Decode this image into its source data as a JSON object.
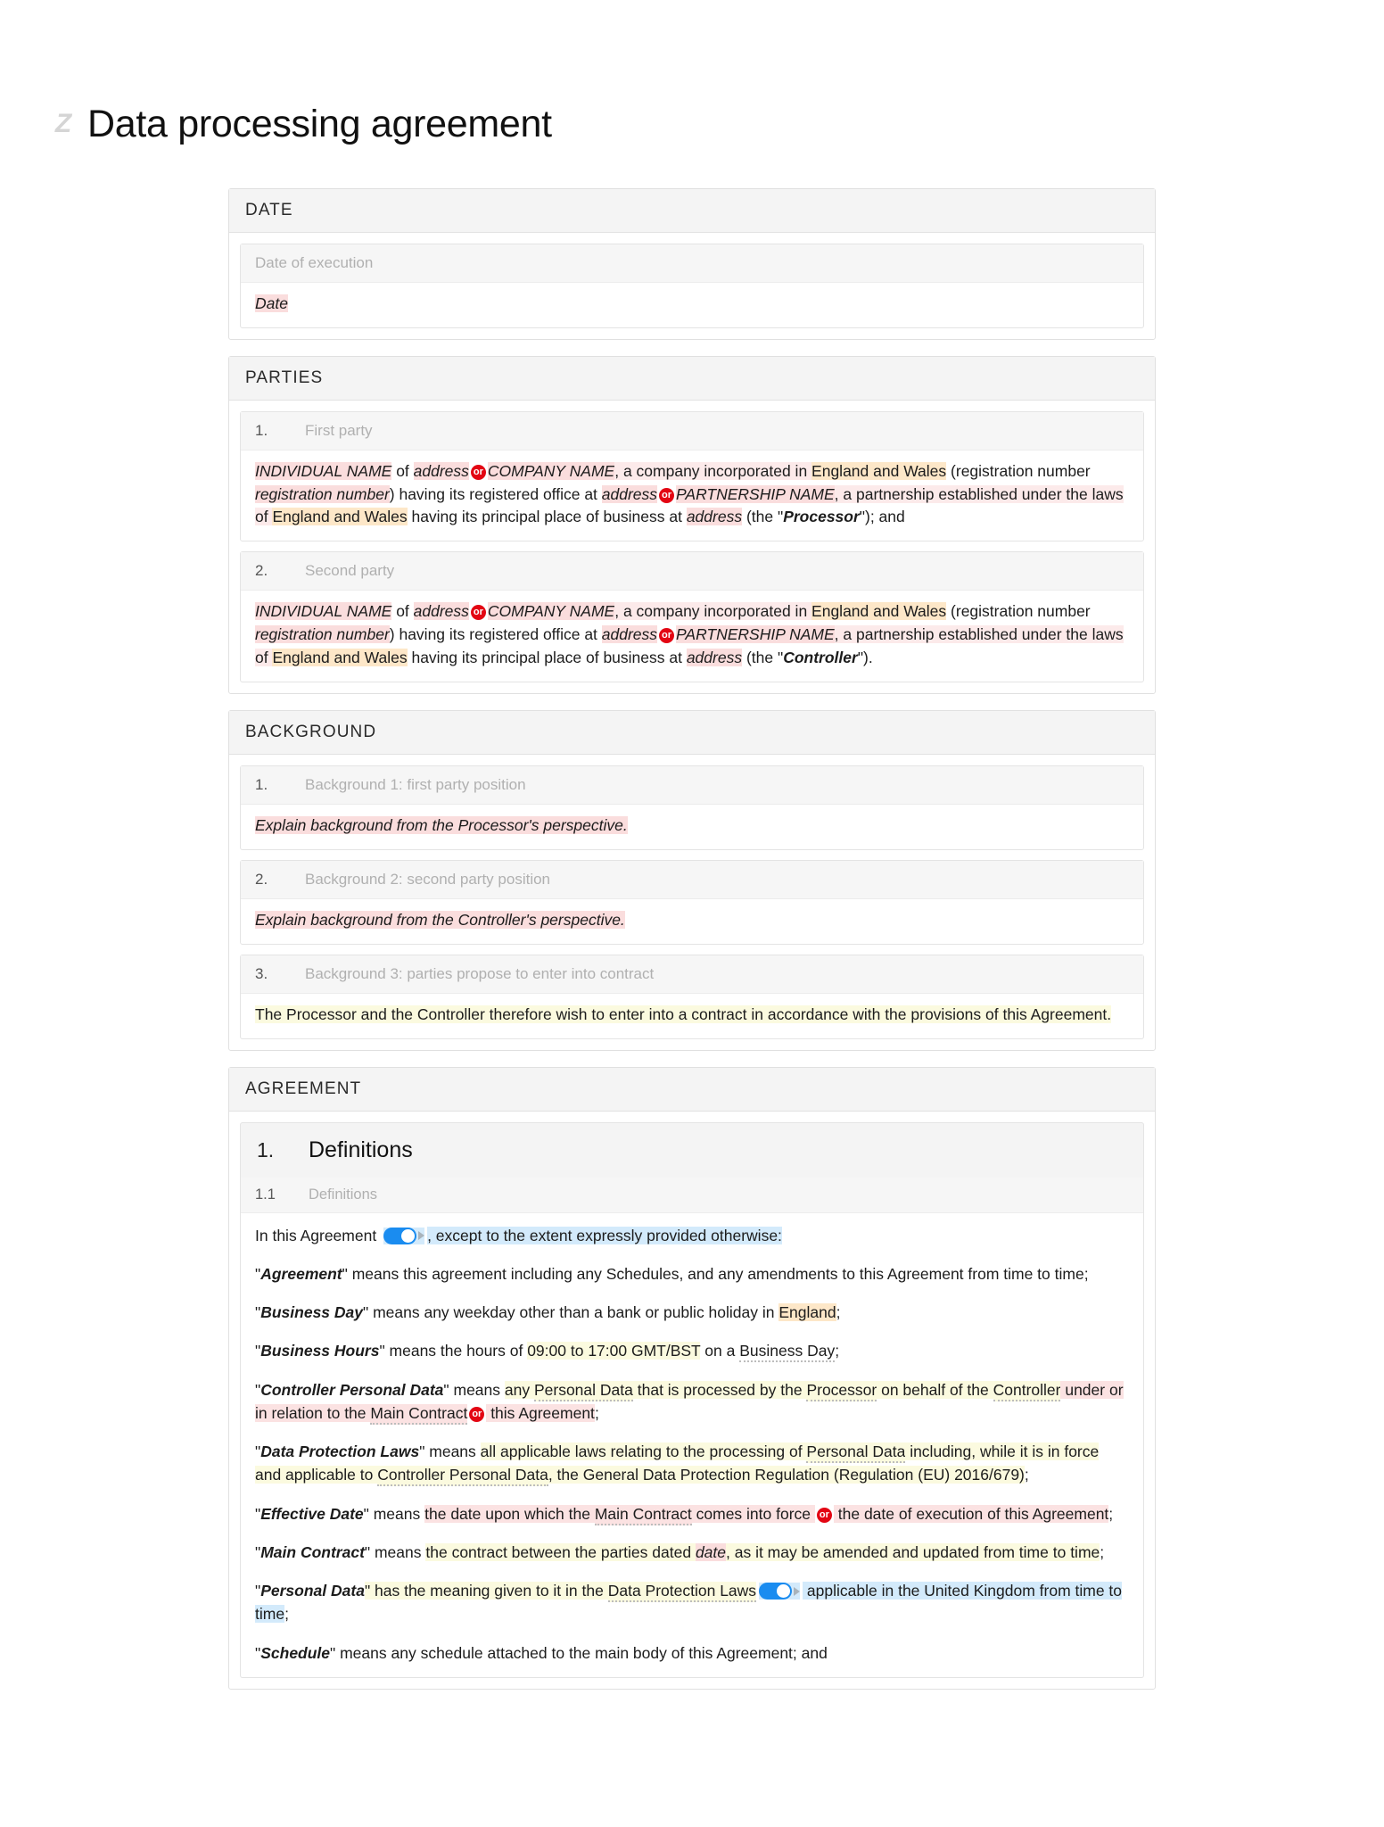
{
  "document": {
    "logo_glyph": "Z",
    "title": "Data processing agreement"
  },
  "sections": {
    "date": {
      "heading": "DATE",
      "clause_label": "Date of execution",
      "value": "Date"
    },
    "parties": {
      "heading": "PARTIES",
      "items": [
        {
          "num": "1.",
          "label": "First party",
          "role": "Processor",
          "text_plain": "INDIVIDUAL NAME of address or COMPANY NAME, a company incorporated in England and Wales (registration number registration number) having its registered office at address or PARTNERSHIP NAME, a partnership established under the laws of England and Wales having its principal place of business at address (the \"Processor\"); and",
          "parts": {
            "individual_name": "INDIVIDUAL NAME",
            "of": " of ",
            "address1": "address",
            "or": "or",
            "company_name": "COMPANY NAME",
            "incorporated": ", a company incorporated in ",
            "jurisdiction1": "England and Wales",
            "reg_open": " (registration number ",
            "registration_number": "registration number",
            "reg_close": ") having its registered office at ",
            "address2": "address",
            "partnership_name": "PARTNERSHIP NAME",
            "partnership_mid": ", a partnership established under the laws of ",
            "jurisdiction2": "England and Wales",
            "principal": " having its principal place of business at ",
            "address3": "address",
            "the_open": " (the \"",
            "the_close": "\"); and"
          }
        },
        {
          "num": "2.",
          "label": "Second party",
          "role": "Controller",
          "text_plain": "INDIVIDUAL NAME of address or COMPANY NAME, a company incorporated in England and Wales (registration number registration number) having its registered office at address or PARTNERSHIP NAME, a partnership established under the laws of England and Wales having its principal place of business at address (the \"Controller\").",
          "parts": {
            "individual_name": "INDIVIDUAL NAME",
            "of": " of ",
            "address1": "address",
            "or": "or",
            "company_name": "COMPANY NAME",
            "incorporated": ", a company incorporated in ",
            "jurisdiction1": "England and Wales",
            "reg_open": " (registration number ",
            "registration_number": "registration number",
            "reg_close": ") having its registered office at ",
            "address2": "address",
            "partnership_name": "PARTNERSHIP NAME",
            "partnership_mid": ", a partnership established under the laws of ",
            "jurisdiction2": "England and Wales",
            "principal": " having its principal place of business at ",
            "address3": "address",
            "the_open": " (the \"",
            "the_close": "\")."
          }
        }
      ]
    },
    "background": {
      "heading": "BACKGROUND",
      "items": [
        {
          "num": "1.",
          "label": "Background 1: first party position",
          "text": "Explain background from the Processor's perspective."
        },
        {
          "num": "2.",
          "label": "Background 2: second party position",
          "text": "Explain background from the Controller's perspective."
        },
        {
          "num": "3.",
          "label": "Background 3: parties propose to enter into contract",
          "text": "The Processor and the Controller therefore wish to enter into a contract in accordance with the provisions of this Agreement."
        }
      ]
    },
    "agreement": {
      "heading": "AGREEMENT",
      "clause": {
        "num": "1.",
        "title": "Definitions",
        "sub_num": "1.1",
        "sub_label": "Definitions",
        "intro": {
          "before_toggle": "In this Agreement ",
          "after_toggle": ", except to the extent expressly provided otherwise:",
          "toggle_state": "on"
        },
        "definitions": [
          {
            "term": "Agreement",
            "body_plain": "\" means this agreement including any Schedules, and any amendments to this Agreement from time to time;",
            "parts": {
              "text": "\" means this agreement including any Schedules, and any amendments to this Agreement from time to time;"
            }
          },
          {
            "term": "Business Day",
            "parts": {
              "pre": "\" means any weekday other than a bank or public holiday in ",
              "highlight": "England",
              "post": ";"
            }
          },
          {
            "term": "Business Hours",
            "parts": {
              "pre": "\" means the hours of ",
              "highlight": "09:00 to 17:00 GMT/BST",
              "post": " on a ",
              "defined_ref": "Business Day",
              "tail": ";"
            }
          },
          {
            "term": "Controller Personal Data",
            "parts": {
              "pre": "\" means ",
              "y1": "any ",
              "ref1": "Personal Data",
              "y2": " that is processed by the ",
              "ref2": "Processor",
              "y3": " on behalf of the ",
              "ref3": "Controller",
              "y4": " under or in relation to the ",
              "ref4": "Main Contract",
              "or": "or",
              "p1": " this Agreement",
              "tail": ";"
            }
          },
          {
            "term": "Data Protection Laws",
            "parts": {
              "pre": "\" means ",
              "y1": "all applicable laws relating to the processing of ",
              "ref1": "Personal Data",
              "y2": " including, while it is in force and applicable to ",
              "ref2": "Controller Personal Data",
              "y3": ", the General Data Protection Regulation (Regulation (EU) 2016/679)",
              "tail": ";"
            }
          },
          {
            "term": "Effective Date",
            "parts": {
              "pre": "\" means ",
              "p1": "the date upon which the ",
              "ref1": "Main Contract",
              "p2": " comes into force ",
              "or": "or",
              "p3": " the date of execution of this Agreement",
              "tail": ";"
            }
          },
          {
            "term": "Main Contract",
            "parts": {
              "pre": "\" means ",
              "y1": "the contract between the parties dated ",
              "var": "date",
              "y2": ", as it may be amended and updated from time to time",
              "tail": ";"
            }
          },
          {
            "term": "Personal Data",
            "parts": {
              "pre": "\" has the meaning given to it in the ",
              "y1": "Data Protection Laws",
              "toggle_state": "on",
              "b1": " applicable in the United Kingdom from time to time",
              "tail": ";"
            }
          },
          {
            "term": "Schedule",
            "parts": {
              "text": "\" means any schedule attached to the main body of this Agreement; and"
            }
          }
        ]
      }
    }
  },
  "colors": {
    "placeholder_pink": "#fadddd",
    "option_peach": "#fde7c8",
    "optional_yellow": "#fbfadf",
    "conditional_blue": "#d3eafb",
    "or_badge_red": "#e30613",
    "toggle_blue": "#1a8cf0"
  }
}
